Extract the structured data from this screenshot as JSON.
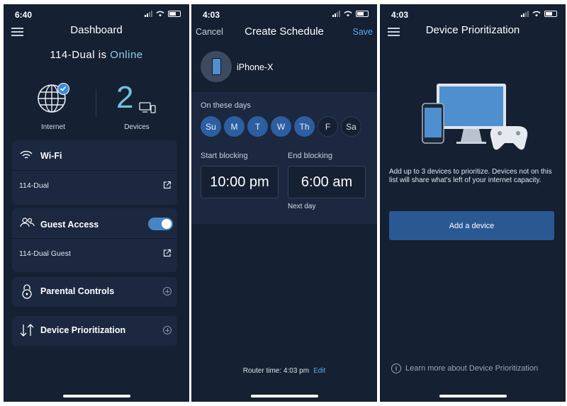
{
  "dashboard": {
    "status_time": "6:40",
    "title": "Dashboard",
    "network_prefix": "114-Dual is",
    "network_status": "Online",
    "internet_label": "Internet",
    "devices_count": "2",
    "devices_label": "Devices",
    "wifi": {
      "title": "Wi-Fi",
      "network": "114-Dual"
    },
    "guest": {
      "title": "Guest Access",
      "network": "114-Dual Guest",
      "enabled": true
    },
    "parental_controls": {
      "title": "Parental Controls"
    },
    "device_prioritization": {
      "title": "Device Prioritization"
    }
  },
  "schedule": {
    "status_time": "4:03",
    "cancel_label": "Cancel",
    "title": "Create Schedule",
    "save_label": "Save",
    "device_name": "iPhone-X",
    "days_label": "On these days",
    "days": [
      {
        "label": "Su",
        "selected": true
      },
      {
        "label": "M",
        "selected": true
      },
      {
        "label": "T",
        "selected": true
      },
      {
        "label": "W",
        "selected": true
      },
      {
        "label": "Th",
        "selected": true
      },
      {
        "label": "F",
        "selected": false
      },
      {
        "label": "Sa",
        "selected": false
      }
    ],
    "start_label": "Start blocking",
    "start_time": "10:00 pm",
    "end_label": "End blocking",
    "end_time": "6:00 am",
    "next_day": "Next day",
    "router_time": "Router time: 4:03 pm",
    "edit_label": "Edit"
  },
  "prioritization": {
    "status_time": "4:03",
    "title": "Device Prioritization",
    "description": "Add up to 3 devices to prioritize. Devices not on this list will share what's left of your internet capacity.",
    "add_button": "Add a device",
    "learn_more": "Learn more about Device Prioritization"
  },
  "colors": {
    "background": "#152033",
    "card": "#1b2840",
    "accent": "#5ea7e8",
    "online": "#8fd1e6",
    "day_selected": "#2d5ea0",
    "button": "#2a5892"
  }
}
